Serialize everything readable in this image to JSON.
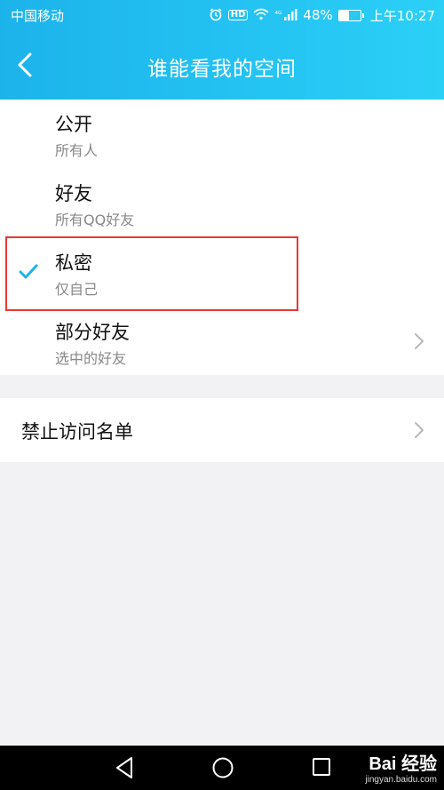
{
  "status_bar": {
    "carrier": "中国移动",
    "hd": "HD",
    "network": "⁴ᴳ",
    "battery": "48%",
    "battery_level": 0.48,
    "time": "上午10:27"
  },
  "header": {
    "title": "谁能看我的空间"
  },
  "options": [
    {
      "title": "公开",
      "subtitle": "所有人",
      "selected": false,
      "has_arrow": false
    },
    {
      "title": "好友",
      "subtitle": "所有QQ好友",
      "selected": false,
      "has_arrow": false
    },
    {
      "title": "私密",
      "subtitle": "仅自己",
      "selected": true,
      "has_arrow": false
    },
    {
      "title": "部分好友",
      "subtitle": "选中的好友",
      "selected": false,
      "has_arrow": true
    }
  ],
  "block_list": {
    "label": "禁止访问名单"
  },
  "colors": {
    "header_start": "#1cb3ea",
    "header_end": "#2bd0f6",
    "check": "#1cb3ea",
    "highlight": "#e53935",
    "background": "#f2f2f4"
  },
  "watermark": {
    "main": "Bai 经验",
    "sub": "jingyan.baidu.com"
  }
}
